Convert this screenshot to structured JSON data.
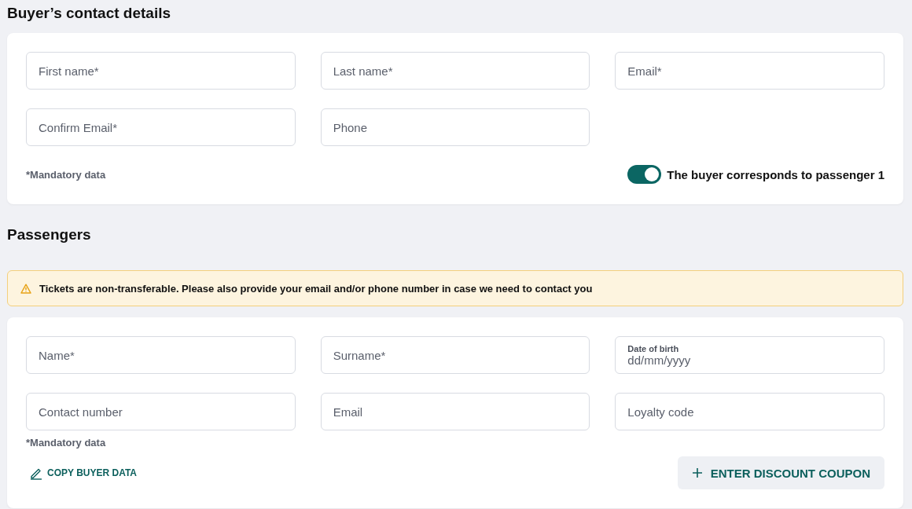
{
  "buyer": {
    "title": "Buyer’s contact details",
    "fields": [
      {
        "kind": "text",
        "placeholder": "First name*"
      },
      {
        "kind": "text",
        "placeholder": "Last name*"
      },
      {
        "kind": "text",
        "placeholder": "Email*"
      },
      {
        "kind": "text",
        "placeholder": "Confirm Email*"
      },
      {
        "kind": "text",
        "placeholder": "Phone"
      }
    ],
    "note": "*Mandatory data",
    "toggle": {
      "label": "The buyer corresponds to passenger 1",
      "on": true
    }
  },
  "passengers": {
    "title": "Passengers",
    "alert": "Tickets are non-transferable. Please also provide your email and/or phone number in case we need to contact you",
    "fields": [
      {
        "kind": "text",
        "placeholder": "Name*"
      },
      {
        "kind": "text",
        "placeholder": "Surname*"
      },
      {
        "kind": "date",
        "label": "Date of birth",
        "placeholder": "dd/mm/yyyy"
      },
      {
        "kind": "text",
        "placeholder": "Contact number"
      },
      {
        "kind": "text",
        "placeholder": "Email"
      },
      {
        "kind": "text",
        "placeholder": "Loyalty code"
      }
    ],
    "note": "*Mandatory data",
    "copy_link": "COPY BUYER DATA",
    "coupon_button": "ENTER DISCOUNT COUPON"
  }
}
